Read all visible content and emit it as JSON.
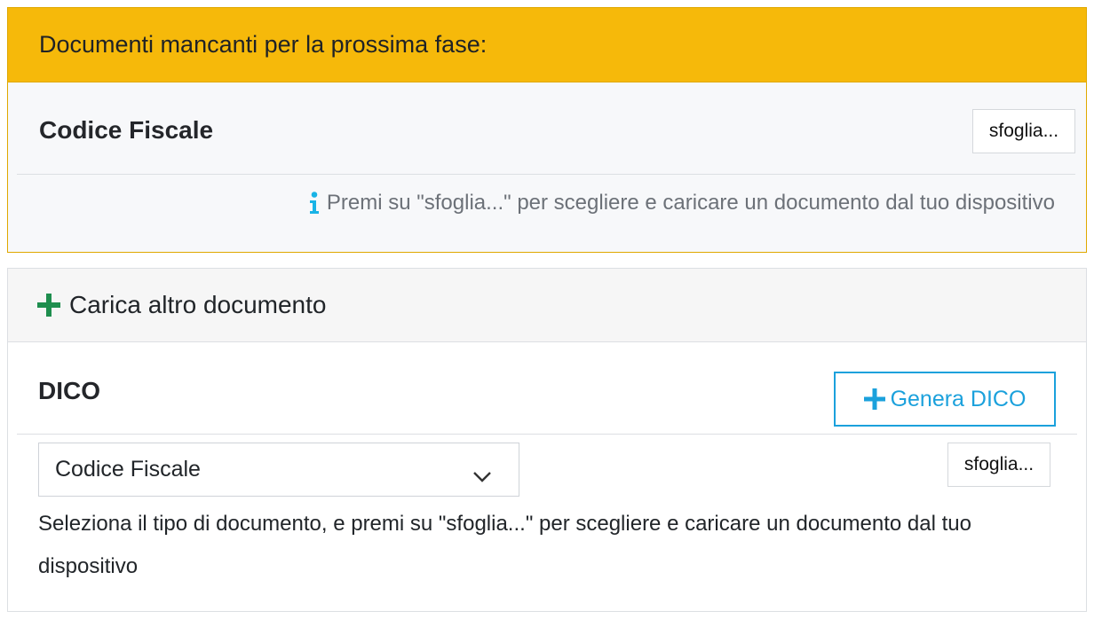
{
  "missing_documents": {
    "header": "Documenti mancanti per la prossima fase:",
    "items": [
      {
        "title": "Codice Fiscale",
        "browse_label": "sfoglia..."
      }
    ],
    "hint": "Premi su \"sfoglia...\" per scegliere e caricare un documento dal tuo dispositivo",
    "hint_icon": "info-icon",
    "accent_color": "#f6b90a"
  },
  "upload_other": {
    "header": "Carica altro documento",
    "header_icon": "plus-icon",
    "section_title": "DICO",
    "generate_button": "Genera DICO",
    "generate_color": "#1ba1dc",
    "document_type": {
      "selected": "Codice Fiscale",
      "icon": "chevron-down-icon"
    },
    "browse_label": "sfoglia...",
    "help_text": "Seleziona il tipo di documento, e premi su \"sfoglia...\" per scegliere e caricare un documento dal tuo dispositivo"
  }
}
